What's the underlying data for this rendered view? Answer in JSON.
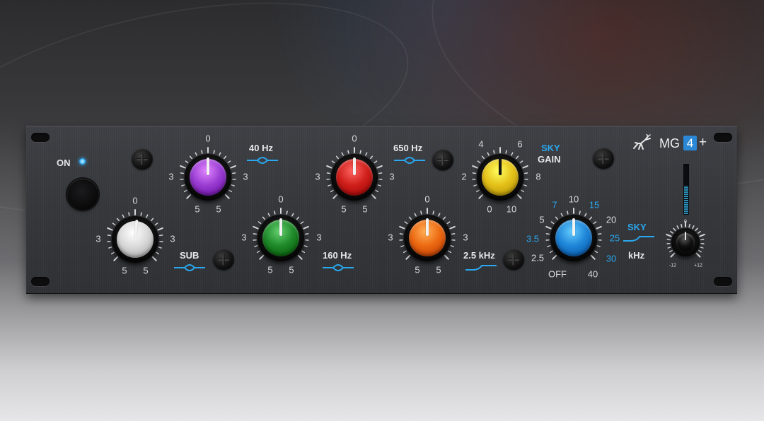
{
  "plugin": {
    "logo_text": "MG",
    "logo_badge": "4",
    "logo_plus": "+",
    "on_label": "ON",
    "power_on": true
  },
  "labels": {
    "hz40": "40 Hz",
    "hz650": "650 Hz",
    "sky_gain_1": "SKY",
    "sky_gain_2": "GAIN",
    "sub": "SUB",
    "hz160": "160 Hz",
    "khz25": "2.5 kHz",
    "sky": "SKY",
    "khz": "kHz"
  },
  "knobs": {
    "sub": {
      "color": "#d9d9d9",
      "top": "0",
      "left": "3",
      "right": "3",
      "bl": "5",
      "br": "5"
    },
    "band40": {
      "color": "#9b3fd4",
      "top": "0",
      "left": "3",
      "right": "3",
      "bl": "5",
      "br": "5"
    },
    "band160": {
      "color": "#1f8a2a",
      "top": "0",
      "left": "3",
      "right": "3",
      "bl": "5",
      "br": "5"
    },
    "band650": {
      "color": "#d0201c",
      "top": "0",
      "left": "3",
      "right": "3",
      "bl": "5",
      "br": "5"
    },
    "band2k5": {
      "color": "#ec6a12",
      "top": "0",
      "left": "3",
      "right": "3",
      "bl": "5",
      "br": "5"
    },
    "sky_gain": {
      "color": "#e5c21a",
      "scale": [
        "4",
        "6",
        "2",
        "8",
        "0",
        "10"
      ]
    },
    "sky_freq": {
      "color": "#1f86d8",
      "scale_white": [
        "10",
        "5",
        "20",
        "2.5",
        "OFF",
        "40"
      ],
      "scale_blue": [
        "7",
        "15",
        "3.5",
        "25",
        "30"
      ]
    },
    "output": {
      "color": "#111111",
      "top": "0",
      "min": "-12",
      "max": "+12"
    }
  },
  "icons": {
    "deer": "antelope-logo-icon",
    "peak": "peak-filter-icon",
    "shelf": "high-shelf-icon"
  },
  "meter": {
    "level": 0.55
  },
  "colors": {
    "accent_blue": "#2aa7ef"
  }
}
